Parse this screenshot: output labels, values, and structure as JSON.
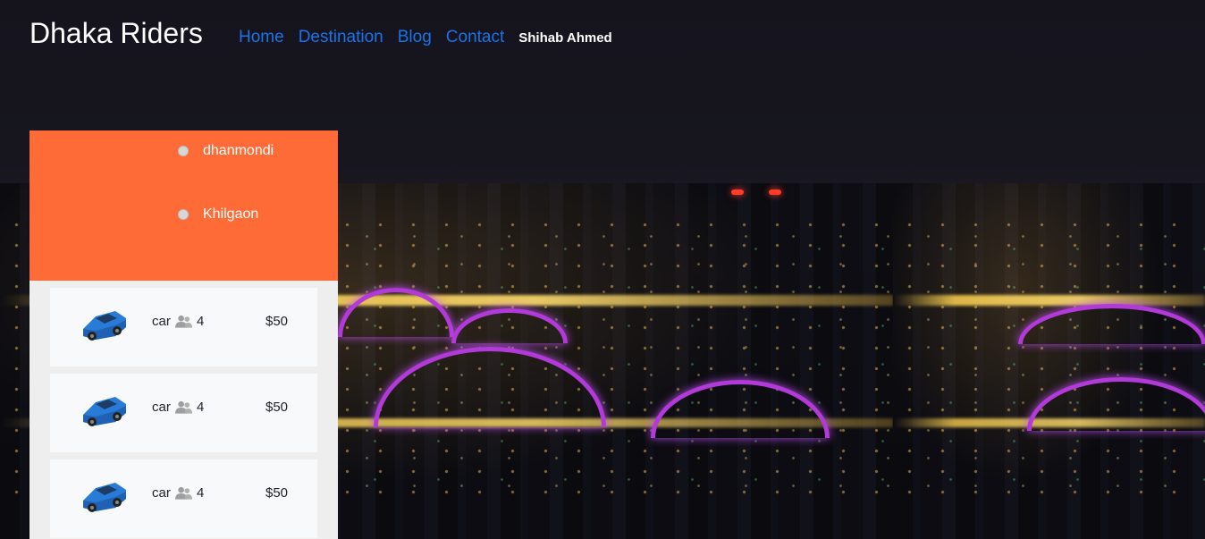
{
  "header": {
    "brand": "Dhaka Riders",
    "nav": [
      {
        "label": "Home",
        "color": "#1a73e8"
      },
      {
        "label": "Destination",
        "color": "#1a73e8"
      },
      {
        "label": "Blog",
        "color": "#1a73e8"
      },
      {
        "label": "Contact",
        "color": "#1a73e8"
      }
    ],
    "user": "Shihab Ahmed"
  },
  "route": {
    "accent": "#ff6b37",
    "from": "dhanmondi",
    "to": "Khilgaon"
  },
  "rides": [
    {
      "icon": "car-icon",
      "type": "car",
      "capacity_icon": "people-icon",
      "capacity": "4",
      "price": "$50"
    },
    {
      "icon": "car-icon",
      "type": "car",
      "capacity_icon": "people-icon",
      "capacity": "4",
      "price": "$50"
    },
    {
      "icon": "car-icon",
      "type": "car",
      "capacity_icon": "people-icon",
      "capacity": "4",
      "price": "$50"
    }
  ]
}
